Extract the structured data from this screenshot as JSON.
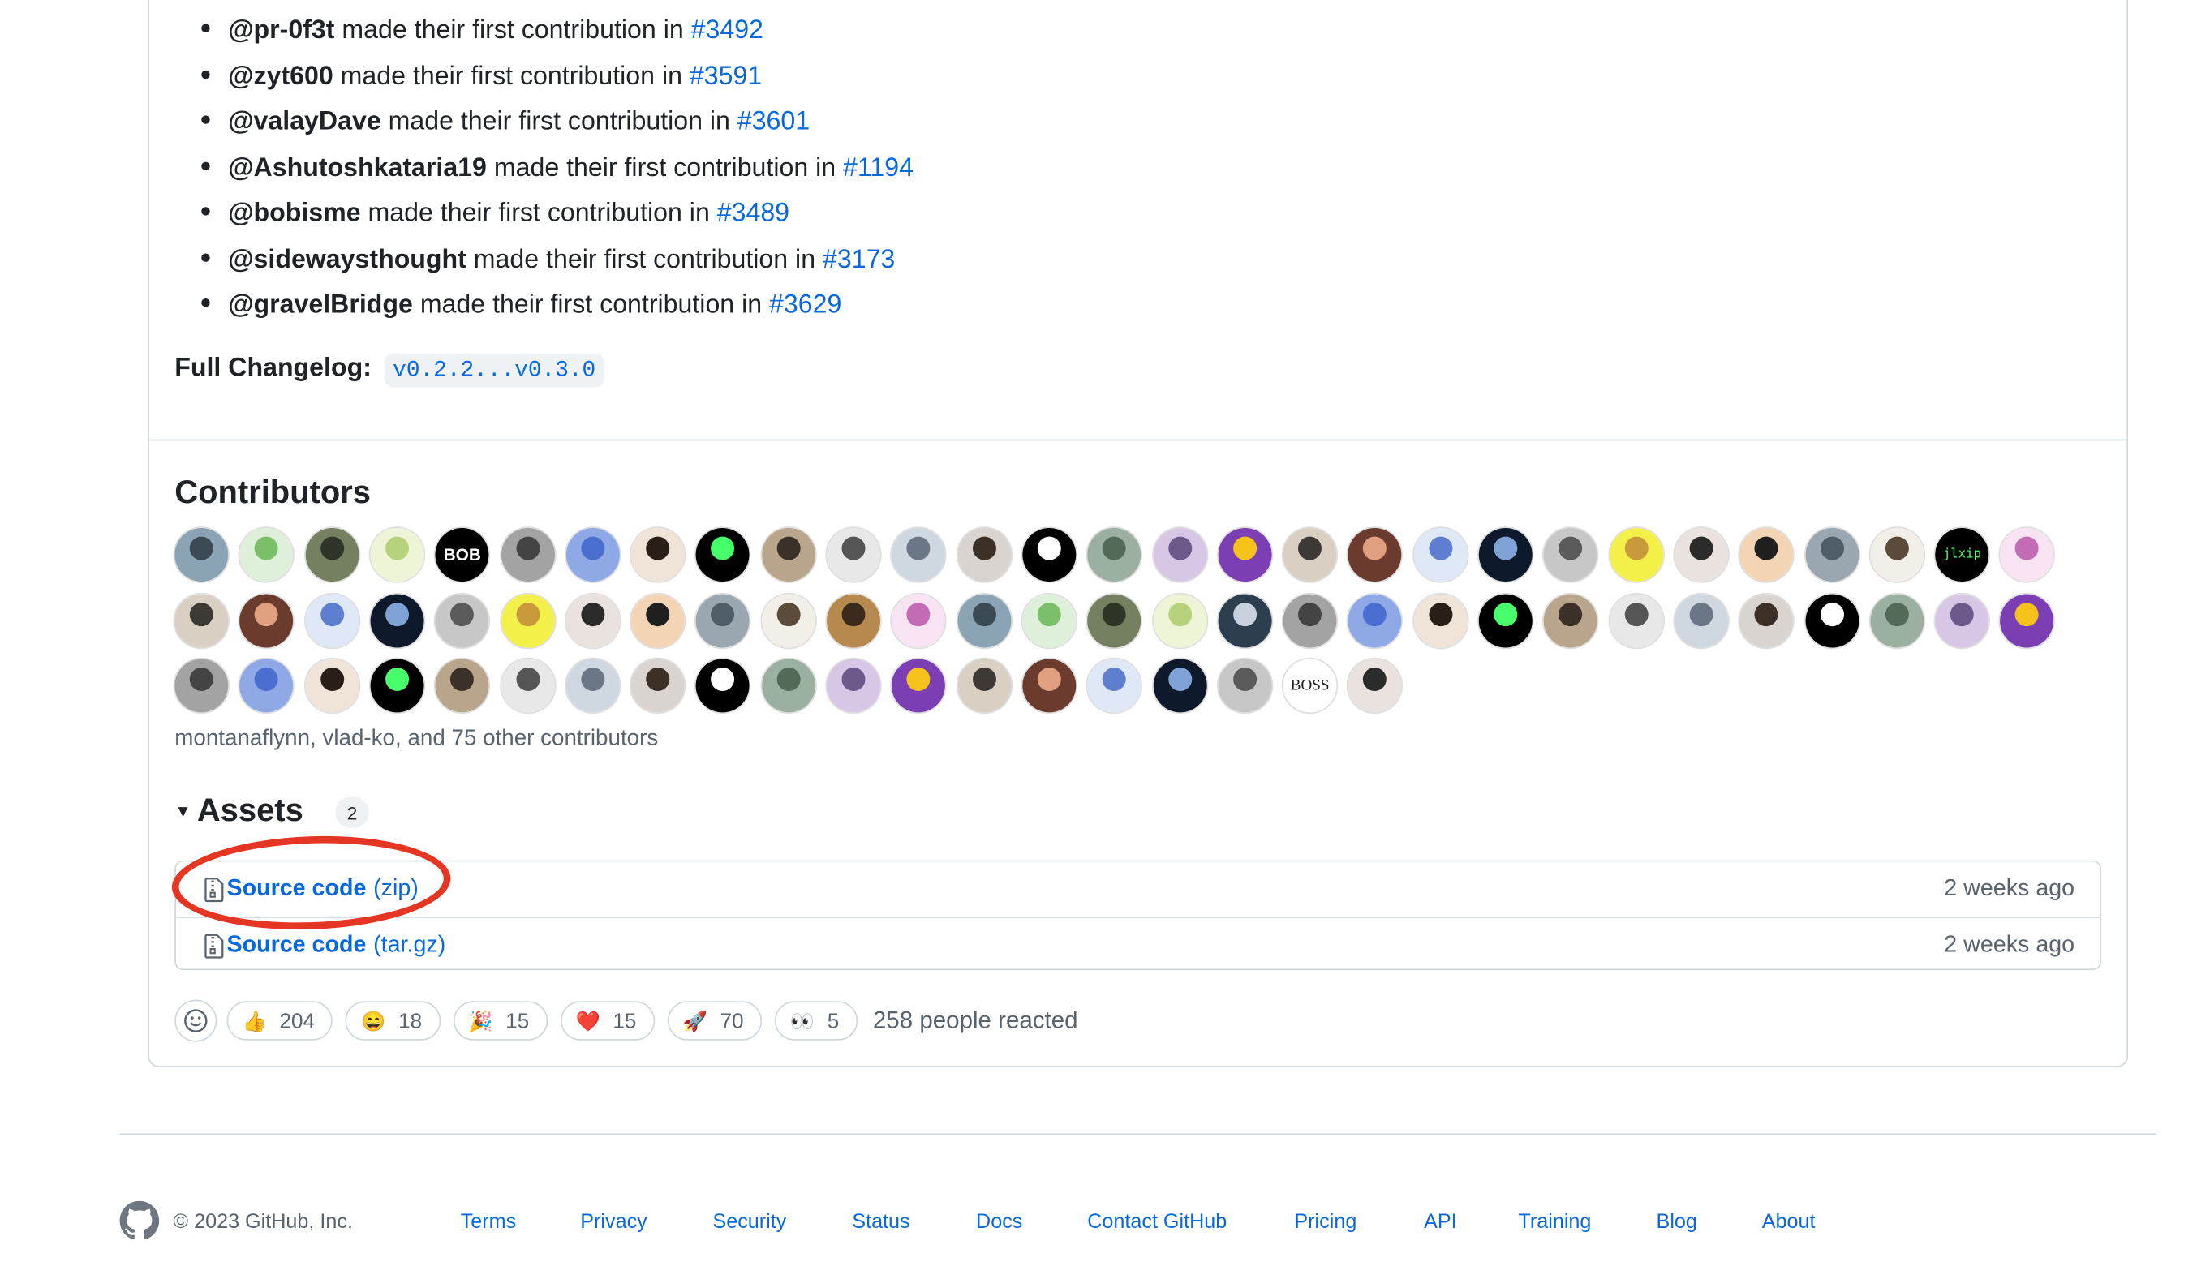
{
  "release_notes": {
    "new_contributors": [
      {
        "user": "@pr-0f3t",
        "text": "made their first contribution in",
        "pr": "#3492"
      },
      {
        "user": "@zyt600",
        "text": "made their first contribution in",
        "pr": "#3591"
      },
      {
        "user": "@valayDave",
        "text": "made their first contribution in",
        "pr": "#3601"
      },
      {
        "user": "@Ashutoshkataria19",
        "text": "made their first contribution in",
        "pr": "#1194"
      },
      {
        "user": "@bobisme",
        "text": "made their first contribution in",
        "pr": "#3489"
      },
      {
        "user": "@sidewaysthought",
        "text": "made their first contribution in",
        "pr": "#3173"
      },
      {
        "user": "@gravelBridge",
        "text": "made their first contribution in",
        "pr": "#3629"
      }
    ],
    "changelog_label": "Full Changelog:",
    "changelog_range": "v0.2.2...v0.3.0"
  },
  "contributors": {
    "title": "Contributors",
    "summary": "montanaflynn, vlad-ko, and 75 other contributors",
    "avatar_labels": {
      "bob": "BOB",
      "jlxip": "jlxip",
      "boss": "BOSS"
    }
  },
  "assets": {
    "title": "Assets",
    "count": "2",
    "items": [
      {
        "name": "Source code",
        "ext": "(zip)",
        "date": "2 weeks ago"
      },
      {
        "name": "Source code",
        "ext": "(tar.gz)",
        "date": "2 weeks ago"
      }
    ]
  },
  "reactions": {
    "items": [
      {
        "emoji": "👍",
        "count": "204"
      },
      {
        "emoji": "😄",
        "count": "18"
      },
      {
        "emoji": "🎉",
        "count": "15"
      },
      {
        "emoji": "❤️",
        "count": "15"
      },
      {
        "emoji": "🚀",
        "count": "70"
      },
      {
        "emoji": "👀",
        "count": "5"
      }
    ],
    "summary": "258 people reacted"
  },
  "footer": {
    "copyright": "© 2023 GitHub, Inc.",
    "links": [
      "Terms",
      "Privacy",
      "Security",
      "Status",
      "Docs",
      "Contact GitHub",
      "Pricing",
      "API",
      "Training",
      "Blog",
      "About"
    ]
  }
}
